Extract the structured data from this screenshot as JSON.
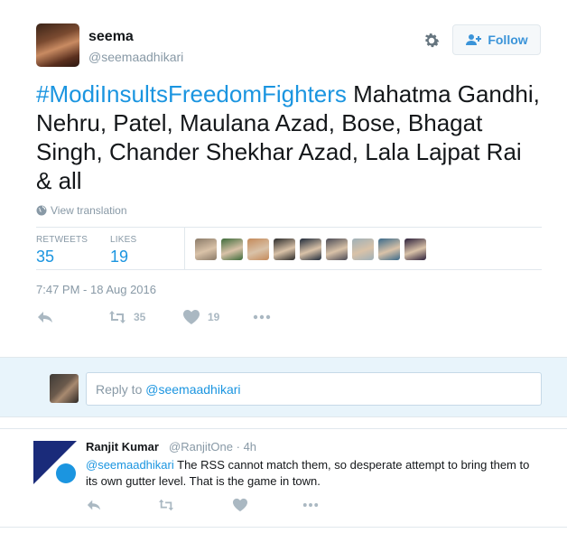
{
  "tweet": {
    "author_name": "seema",
    "author_handle": "@seemaadhikari",
    "follow_label": "Follow",
    "hashtag": "#ModiInsultsFreedomFighters",
    "text": " Mahatma Gandhi, Nehru, Patel, Maulana Azad, Bose, Bhagat Singh, Chander Shekhar Azad, Lala Lajpat Rai & all",
    "view_translation": "View translation",
    "retweets_label": "RETWEETS",
    "retweets_count": "35",
    "likes_label": "LIKES",
    "likes_count": "19",
    "timestamp": "7:47 PM - 18 Aug 2016",
    "action_retweet_count": "35",
    "action_like_count": "19",
    "icons": [
      "settings-gear-icon",
      "follow-person-icon",
      "globe-icon",
      "reply-icon",
      "retweet-icon",
      "heart-icon",
      "more-icon"
    ]
  },
  "likers": [
    {
      "name": "liker-1",
      "color": "#8a7a68"
    },
    {
      "name": "liker-2",
      "color": "#3d6b3a"
    },
    {
      "name": "liker-3",
      "color": "#c48a5a"
    },
    {
      "name": "liker-4",
      "color": "#2a2a2a"
    },
    {
      "name": "liker-5",
      "color": "#1f2a3a"
    },
    {
      "name": "liker-6",
      "color": "#4a4a55"
    },
    {
      "name": "liker-7",
      "color": "#9fb0b8"
    },
    {
      "name": "liker-8",
      "color": "#3a6a8a"
    },
    {
      "name": "liker-9",
      "color": "#2b1f3a"
    }
  ],
  "reply_composer": {
    "prefix": "Reply to ",
    "mention": "@seemaadhikari"
  },
  "reply_tweet": {
    "author_name": "Ranjit Kumar",
    "author_handle": "@RanjitOne",
    "separator": " · ",
    "time": "4h",
    "mention": "@seemaadhikari",
    "text": " The RSS cannot match them, so desperate attempt to bring them to its own gutter level. That is the game in town."
  },
  "colors": {
    "link_blue": "#1b95e0",
    "gray_text": "#8899a6",
    "action_gray": "#aab8c2",
    "reply_bg": "#e8f4fb",
    "avatar_navy": "#1a2b7a",
    "avatar_blue": "#1b95e0"
  }
}
